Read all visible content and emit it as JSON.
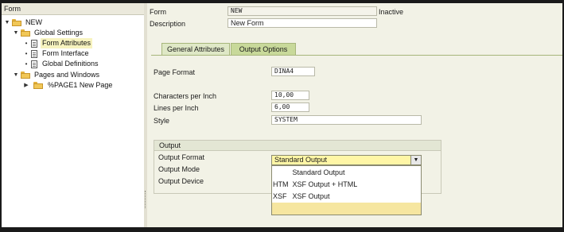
{
  "tree": {
    "header": "Form",
    "root": "NEW",
    "global_settings": "Global Settings",
    "items": [
      "Form Attributes",
      "Form Interface",
      "Global Definitions"
    ],
    "pages_windows": "Pages and Windows",
    "page1": "%PAGE1 New Page"
  },
  "header": {
    "form_label": "Form",
    "form_value": "NEW",
    "status": "Inactive",
    "description_label": "Description",
    "description_value": "New Form"
  },
  "tabs": [
    "General Attributes",
    "Output Options"
  ],
  "output_options": {
    "page_format_label": "Page Format",
    "page_format_value": "DINA4",
    "cpi_label": "Characters per Inch",
    "cpi_value": "10,00",
    "lpi_label": "Lines per Inch",
    "lpi_value": "6,00",
    "style_label": "Style",
    "style_value": "SYSTEM"
  },
  "output_group": {
    "title": "Output",
    "format_label": "Output Format",
    "mode_label": "Output Mode",
    "device_label": "Output Device",
    "format_value": "Standard Output",
    "options": [
      {
        "key": "",
        "label": "Standard Output"
      },
      {
        "key": "HTM",
        "label": "XSF Output + HTML"
      },
      {
        "key": "XSF",
        "label": "XSF Output"
      }
    ]
  },
  "colors": {
    "tab_active": "#c8d99a",
    "tab_inactive": "#dfe8c6",
    "dropdown_field": "#fff6a6",
    "selected_tree_item": "#f7f3bf"
  }
}
